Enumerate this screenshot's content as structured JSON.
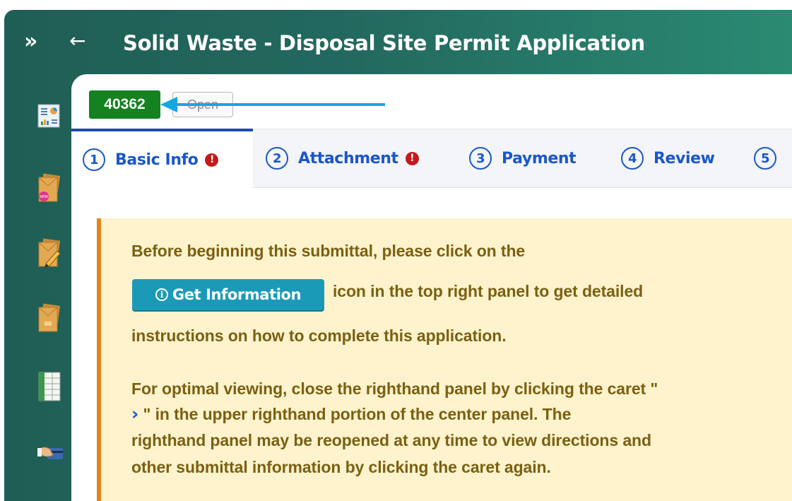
{
  "header": {
    "expand_icon": "»",
    "back_icon": "←",
    "title": "Solid Waste - Disposal Site Permit Application"
  },
  "sidebar": {
    "items": [
      {
        "icon": "dashboard-chart-icon"
      },
      {
        "icon": "new-application-envelope-icon"
      },
      {
        "icon": "edit-application-envelope-icon"
      },
      {
        "icon": "applications-envelope-icon"
      },
      {
        "icon": "spreadsheet-icon"
      },
      {
        "icon": "payment-card-icon"
      }
    ]
  },
  "record": {
    "id": "40362",
    "status": "Open"
  },
  "tabs": [
    {
      "num": "1",
      "label": "Basic Info",
      "error": "!",
      "active": true
    },
    {
      "num": "2",
      "label": "Attachment",
      "error": "!"
    },
    {
      "num": "3",
      "label": "Payment"
    },
    {
      "num": "4",
      "label": "Review"
    },
    {
      "num": "5",
      "label": ""
    }
  ],
  "notice": {
    "line1": "Before beginning this submittal, please click on the",
    "button_label": "Get Information",
    "line2": "icon in the top right panel to get detailed",
    "line3": "instructions on how to complete this application.",
    "line4": "For optimal viewing, close the righthand panel by clicking the caret \"",
    "caret": "›",
    "line5": " \" in the upper righthand portion of the center panel. The",
    "line6": "righthand panel may be reopened at any time to view directions and",
    "line7": "other submittal information by clicking the caret again."
  },
  "colors": {
    "header_bg": "#23695f",
    "id_badge": "#14821f",
    "tab_text": "#1a57c8",
    "error": "#c41a1a",
    "notice_bg": "#fff3cd",
    "notice_border": "#e0861a",
    "notice_text": "#7a6012",
    "info_button": "#1b9ab8",
    "annotation_arrow": "#16a7e0"
  }
}
